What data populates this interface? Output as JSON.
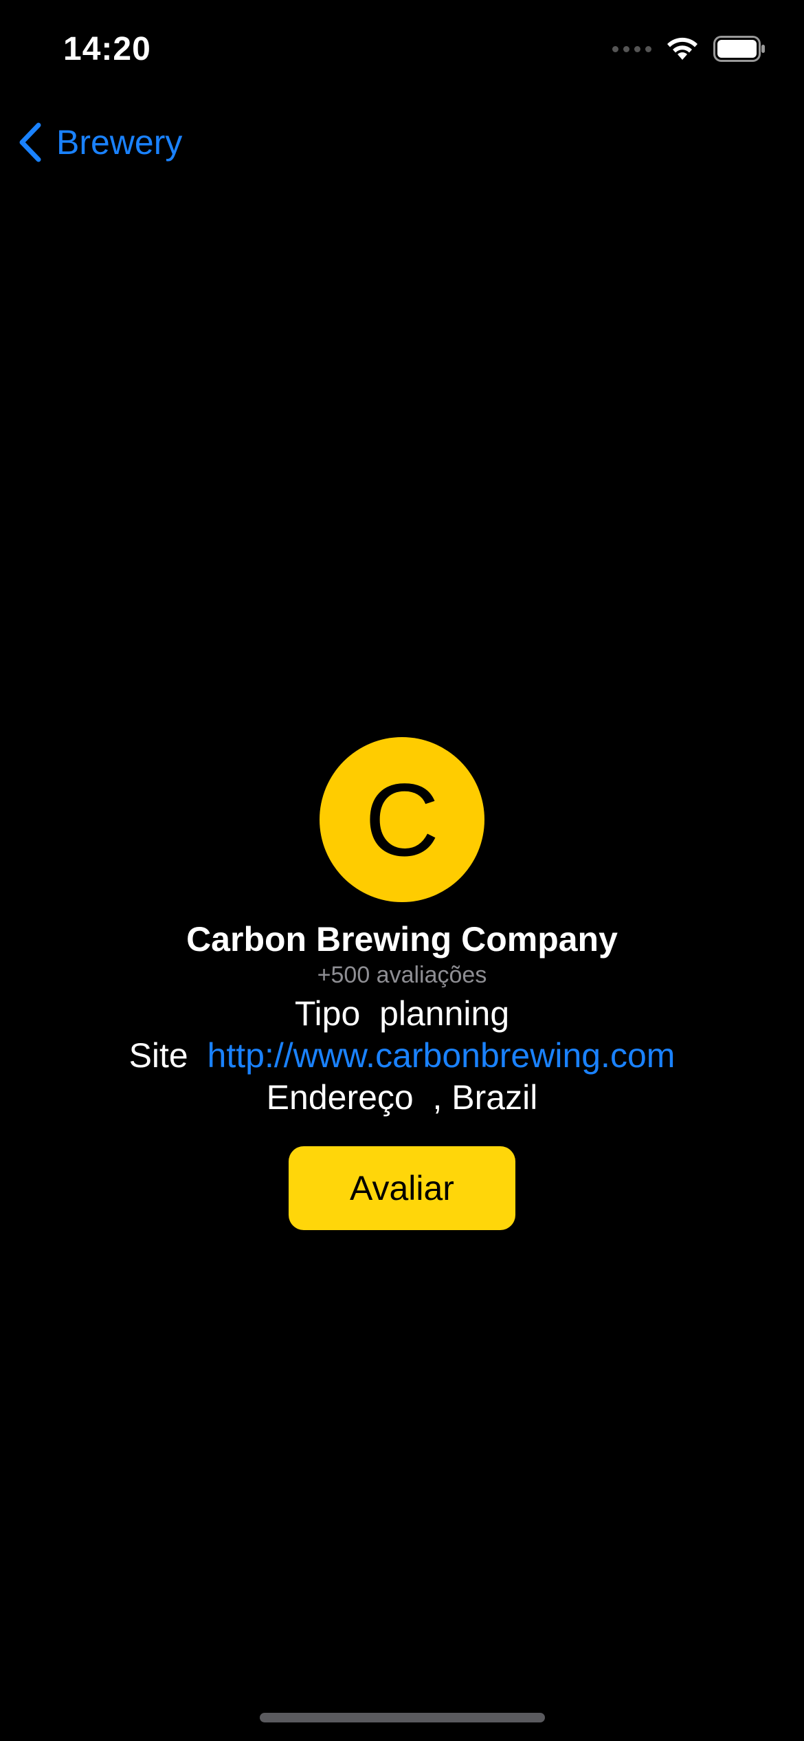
{
  "status_bar": {
    "time": "14:20",
    "icons": [
      "signal-icon",
      "wifi-icon",
      "battery-icon"
    ]
  },
  "nav": {
    "back_label": "Brewery",
    "back_icon": "chevron-left-icon"
  },
  "brewery": {
    "avatar_letter": "C",
    "name": "Carbon Brewing Company",
    "reviews": "+500 avaliações",
    "type_label": "Tipo",
    "type_value": "planning",
    "site_label": "Site",
    "site_value": "http://www.carbonbrewing.com",
    "address_label": "Endereço",
    "address_value": ", Brazil"
  },
  "actions": {
    "rate_label": "Avaliar"
  },
  "colors": {
    "background": "#000000",
    "accent_blue": "#1a82ff",
    "avatar_yellow": "#ffcc00",
    "button_yellow": "#ffd60a",
    "secondary_text": "#8e8e93"
  }
}
